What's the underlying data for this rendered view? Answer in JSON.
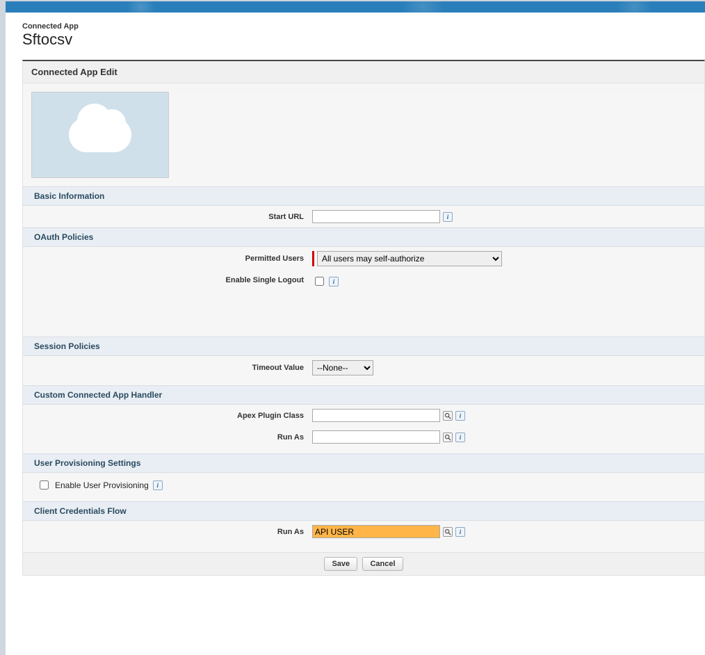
{
  "breadcrumb": "Connected App",
  "page_title": "Sftocsv",
  "panel_title": "Connected App Edit",
  "sections": {
    "basic": {
      "title": "Basic Information",
      "start_url_label": "Start URL",
      "start_url_value": ""
    },
    "oauth": {
      "title": "OAuth Policies",
      "permitted_users_label": "Permitted Users",
      "permitted_users_value": "All users may self-authorize",
      "enable_slo_label": "Enable Single Logout",
      "enable_slo_checked": false
    },
    "session": {
      "title": "Session Policies",
      "timeout_label": "Timeout Value",
      "timeout_value": "--None--"
    },
    "handler": {
      "title": "Custom Connected App Handler",
      "apex_label": "Apex Plugin Class",
      "apex_value": "",
      "run_as_label": "Run As",
      "run_as_value": ""
    },
    "provisioning": {
      "title": "User Provisioning Settings",
      "enable_label": "Enable User Provisioning",
      "enable_checked": false
    },
    "client_cred": {
      "title": "Client Credentials Flow",
      "run_as_label": "Run As",
      "run_as_value": "API USER"
    }
  },
  "buttons": {
    "save": "Save",
    "cancel": "Cancel"
  },
  "icons": {
    "info": "i"
  }
}
